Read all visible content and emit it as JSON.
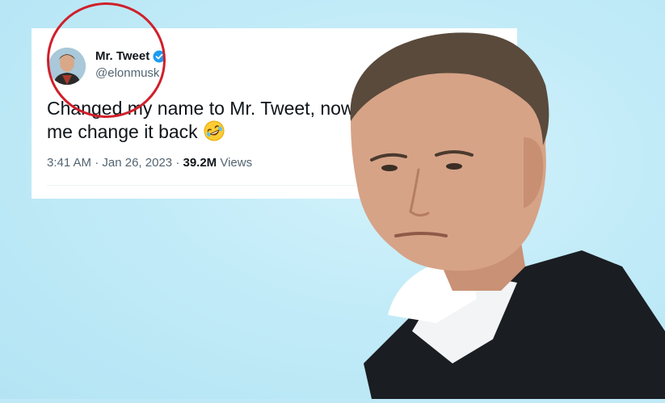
{
  "tweet": {
    "display_name": "Mr. Tweet",
    "handle": "@elonmusk",
    "text_line1": "Changed my name to Mr. Tweet, now Twitter won't let",
    "text_line2": "me change it back",
    "emoji": "rolling-on-the-floor-laughing-emoji",
    "time": "3:41 AM",
    "separator": "·",
    "date": "Jan 26, 2023",
    "views_count": "39.2M",
    "views_label": "Views"
  },
  "colors": {
    "background": "#bfe9f7",
    "card": "#ffffff",
    "verified": "#1d9bf0",
    "annotation_circle": "#d0202a",
    "text_primary": "#0f1419",
    "text_secondary": "#536471"
  },
  "icons": {
    "verified": "verified-badge-icon",
    "more": "more-dots-icon"
  }
}
